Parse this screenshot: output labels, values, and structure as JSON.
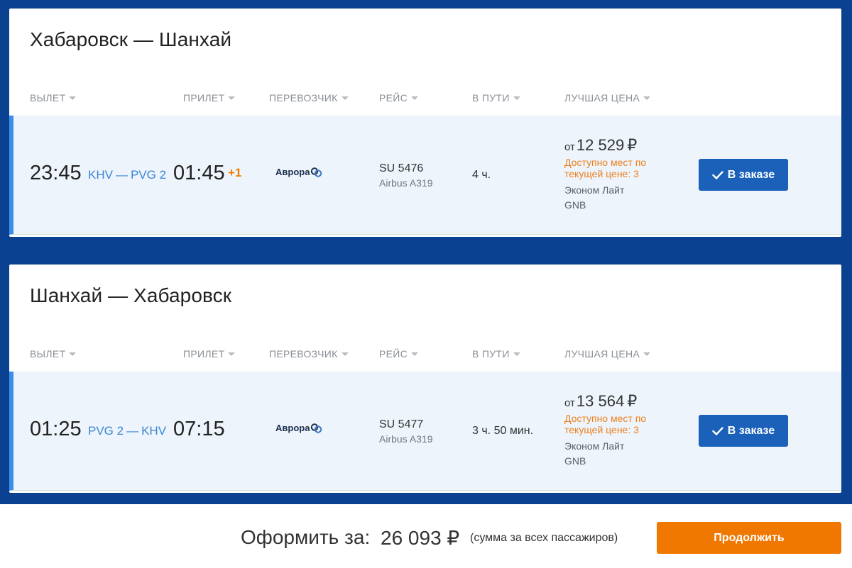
{
  "columns": {
    "departure": "ВЫЛЕТ",
    "arrival": "ПРИЛЕТ",
    "carrier": "ПЕРЕВОЗЧИК",
    "flight": "РЕЙС",
    "duration": "В ПУТИ",
    "best_price": "ЛУЧШАЯ ЦЕНА"
  },
  "segments": [
    {
      "title": "Хабаровск — Шанхай",
      "departure_time": "23:45",
      "from_airport": "KHV",
      "dash": "—",
      "to_airport": "PVG 2",
      "arrival_time": "01:45",
      "next_day": "+1",
      "airline": "Аврора",
      "flight_number": "SU 5476",
      "aircraft": "Airbus A319",
      "duration": "4 ч.",
      "price_prefix": "от",
      "price": "12 529",
      "currency": "₽",
      "availability": "Доступно мест по текущей цене: 3",
      "fare_class": "Эконом Лайт",
      "fare_code": "GNB",
      "button_label": "В заказе"
    },
    {
      "title": "Шанхай — Хабаровск",
      "departure_time": "01:25",
      "from_airport": "PVG 2",
      "dash": "—",
      "to_airport": "KHV",
      "arrival_time": "07:15",
      "next_day": "",
      "airline": "Аврора",
      "flight_number": "SU 5477",
      "aircraft": "Airbus A319",
      "duration": "3 ч. 50 мин.",
      "price_prefix": "от",
      "price": "13 564",
      "currency": "₽",
      "availability": "Доступно мест по текущей цене: 3",
      "fare_class": "Эконом Лайт",
      "fare_code": "GNB",
      "button_label": "В заказе"
    }
  ],
  "footer": {
    "total_label": "Оформить за:",
    "total_value": "26 093 ₽",
    "total_note": "(сумма за всех пассажиров)",
    "continue_label": "Продолжить"
  },
  "colors": {
    "background": "#0a4190",
    "accent_blue": "#1b61ba",
    "airport_blue": "#3a86d6",
    "orange": "#f07800",
    "row_highlight": "#edf4fb"
  },
  "icons": {
    "sort": "caret-down-icon",
    "check": "check-icon",
    "airline": "aurora-logo-icon"
  }
}
